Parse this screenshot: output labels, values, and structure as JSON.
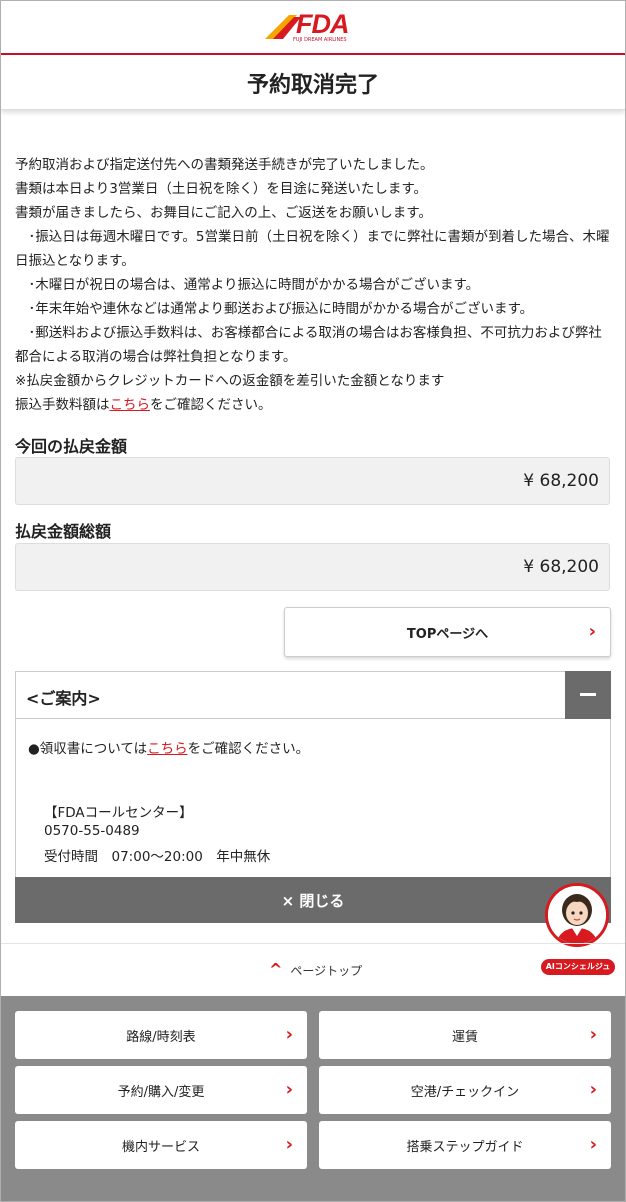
{
  "header": {
    "logo_text": "FDA",
    "logo_sub": "FUJI DREAM AIRLINES"
  },
  "page_title": "予約取消完了",
  "body_lines": [
    "予約取消および指定送付先への書類発送手続きが完了いたしました。",
    "書類は本日より3営業日（土日祝を除く）を目途に発送いたします。",
    "書類が届きましたら、お舞目にご記入の上、ご返送をお願いします。",
    "　･振込日は毎週木曜日です。5営業日前（土日祝を除く）までに弊社に書類が到着した場合、木曜日振込となります。",
    "　･木曜日が祝日の場合は、通常より振込に時間がかかる場合がございます。",
    "　･年末年始や連休などは通常より郵送および振込に時間がかかる場合がございます。",
    "　･郵送料および振込手数料は、お客様都合による取消の場合はお客様負担、不可抗力および弊社都合による取消の場合は弊社負担となります。",
    "※払戻金額からクレジットカードへの返金額を差引いた金額となります"
  ],
  "fee_note": {
    "before": "振込手数料額は",
    "link": "こちら",
    "after": "をご確認ください。"
  },
  "refund_amount": {
    "label": "今回の払戻金額",
    "value": "¥ 68,200"
  },
  "refund_total": {
    "label": "払戻金額総額",
    "value": "¥ 68,200"
  },
  "top_button": {
    "label": "TOPページへ",
    "chevron": "›"
  },
  "guide": {
    "title": "<ご案内>",
    "receipt": {
      "before": "●領収書については",
      "link": "こちら",
      "after": "をご確認ください。"
    },
    "call_center": "【FDAコールセンター】",
    "phone": "0570-55-0489",
    "hours": "受付時間　07:00〜20:00　年中無休",
    "close_label": "× 閉じる"
  },
  "concierge_label": "AIコンシェルジュ",
  "page_top": {
    "chevron": "^",
    "label": "ページトップ"
  },
  "footer_buttons": [
    {
      "label": "路線/時刻表",
      "chevron": "›"
    },
    {
      "label": "運賃",
      "chevron": "›"
    },
    {
      "label": "予約/購入/変更",
      "chevron": "›"
    },
    {
      "label": "空港/チェックイン",
      "chevron": "›"
    },
    {
      "label": "機内サービス",
      "chevron": "›"
    },
    {
      "label": "搭乗ステップガイド",
      "chevron": "›"
    }
  ],
  "colors": {
    "brand_red": "#d71920",
    "dark_gray": "#6b6b6b",
    "footer_gray": "#8a8a8a"
  }
}
